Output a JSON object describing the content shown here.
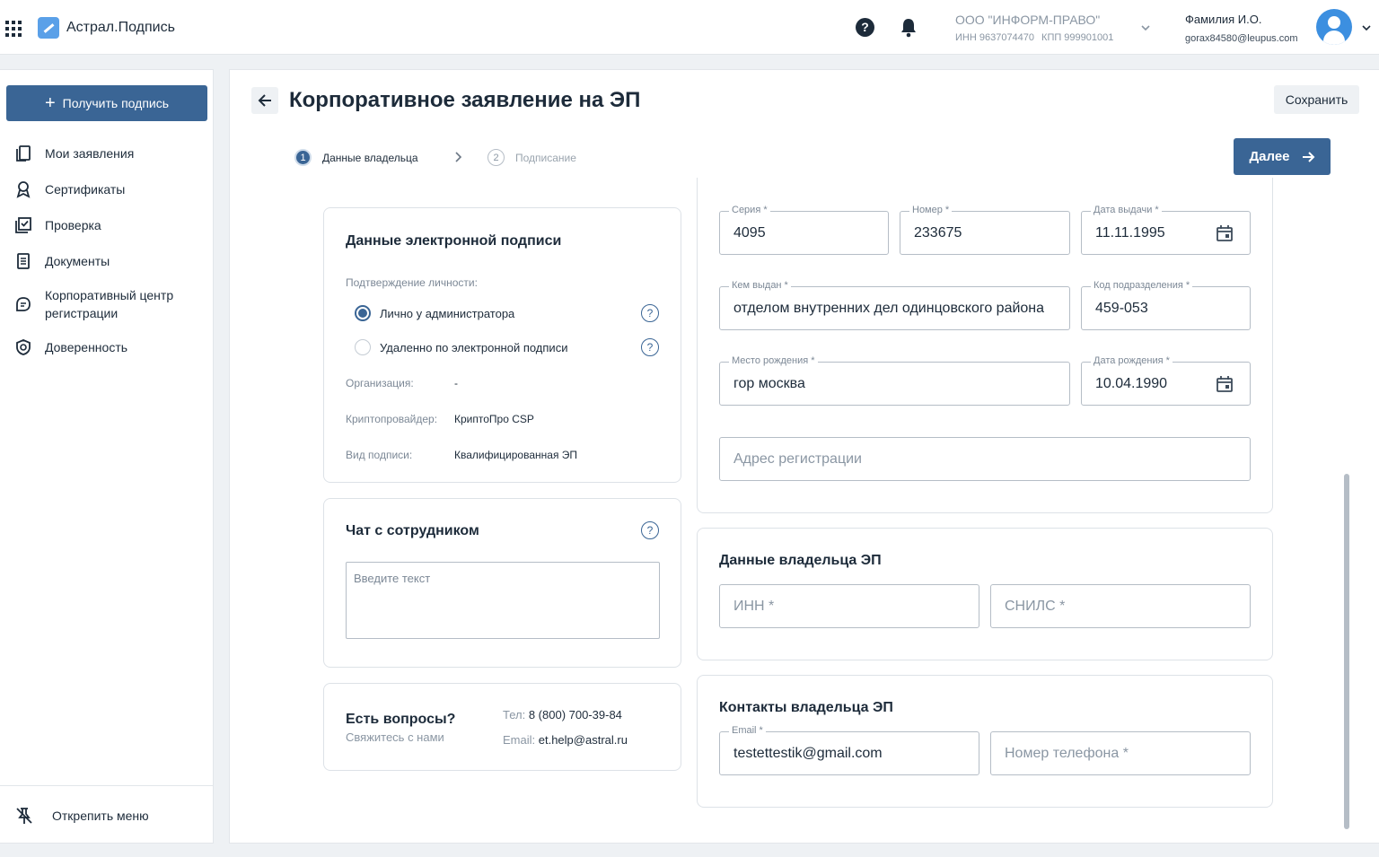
{
  "header": {
    "app_title": "Астрал.Подпись",
    "org_name": "ООО \"ИНФОРМ-ПРАВО\"",
    "org_inn": "ИНН 9637074470",
    "org_kpp": "КПП 999901001",
    "user_name": "Фамилия И.О.",
    "user_email": "gorax84580@leupus.com"
  },
  "sidebar": {
    "get_sign_label": "Получить подпись",
    "items": [
      {
        "label": "Мои заявления",
        "icon": "documents-icon"
      },
      {
        "label": "Сертификаты",
        "icon": "award-icon"
      },
      {
        "label": "Проверка",
        "icon": "check-icon"
      },
      {
        "label": "Документы",
        "icon": "doc-icon"
      },
      {
        "label": "Корпоративный центр регистрации",
        "icon": "chat-icon"
      },
      {
        "label": "Доверенность",
        "icon": "shield-icon"
      }
    ],
    "unpin_label": "Открепить меню"
  },
  "page": {
    "title": "Корпоративное заявление на ЭП",
    "save_label": "Сохранить",
    "next_label": "Далее",
    "steps": [
      {
        "num": "1",
        "label": "Данные владельца"
      },
      {
        "num": "2",
        "label": "Подписание"
      }
    ]
  },
  "signature_card": {
    "title": "Данные электронной подписи",
    "identity_label": "Подтверждение личности:",
    "options": [
      "Лично у администратора",
      "Удаленно по электронной подписи"
    ],
    "selected_option": "Лично у администратора",
    "org_label": "Организация:",
    "org_value": "-",
    "crypto_label": "Криптопровайдер:",
    "crypto_value": "КриптоПро CSP",
    "type_label": "Вид подписи:",
    "type_value": "Квалифицированная ЭП"
  },
  "chat_card": {
    "title": "Чат с сотрудником",
    "placeholder": "Введите текст"
  },
  "contact_card": {
    "title": "Есть вопросы?",
    "subtitle": "Свяжитесь с нами",
    "phone_label": "Тел:",
    "phone_value": "8 (800) 700-39-84",
    "email_label": "Email:",
    "email_value": "et.help@astral.ru"
  },
  "passport": {
    "series_label": "Серия *",
    "series_value": "4095",
    "number_label": "Номер *",
    "number_value": "233675",
    "issue_date_label": "Дата выдачи *",
    "issue_date_value": "11.11.1995",
    "issued_by_label": "Кем выдан *",
    "issued_by_value": "отделом внутренних дел одинцовского района",
    "dept_code_label": "Код подразделения *",
    "dept_code_value": "459-053",
    "birth_place_label": "Место рождения *",
    "birth_place_value": "гор москва",
    "birth_date_label": "Дата рождения *",
    "birth_date_value": "10.04.1990",
    "address_placeholder": "Адрес регистрации"
  },
  "owner": {
    "title": "Данные владельца ЭП",
    "inn_placeholder": "ИНН *",
    "snils_placeholder": "СНИЛС *"
  },
  "contacts": {
    "title": "Контакты владельца ЭП",
    "email_label": "Email *",
    "email_value": "testettestik@gmail.com",
    "phone_placeholder": "Номер телефона *"
  }
}
